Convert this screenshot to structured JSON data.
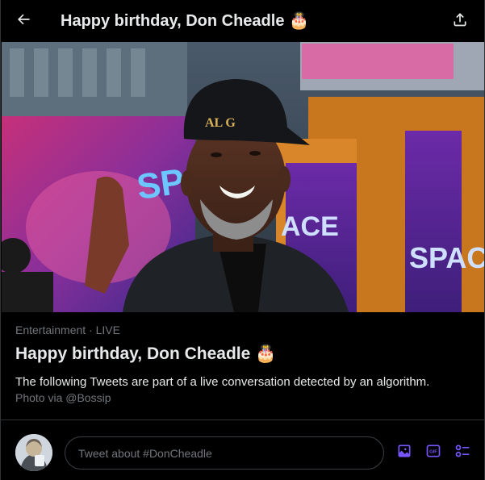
{
  "header": {
    "title": "Happy birthday, Don Cheadle 🎂",
    "back_icon": "arrow-left-icon",
    "share_icon": "share-icon"
  },
  "hero": {
    "cap_text": "AL G",
    "poster_text_left": "SPAC",
    "poster_text_right": "SPAC",
    "poster_text_center": "ACE"
  },
  "topic": {
    "category": "Entertainment",
    "separator": "·",
    "status": "LIVE",
    "title": "Happy birthday, Don Cheadle 🎂",
    "description": "The following Tweets are part of a live conversation detected by an algorithm.",
    "credit": "Photo via @Bossip"
  },
  "composer": {
    "placeholder": "Tweet about #DonCheadle",
    "gif_label": "GIF",
    "tools": [
      "media-icon",
      "gif-icon",
      "poll-icon"
    ]
  },
  "colors": {
    "accent": "#1d9bf0",
    "tool_purple": "#7856ff",
    "background": "#000000",
    "muted": "#71767b"
  }
}
